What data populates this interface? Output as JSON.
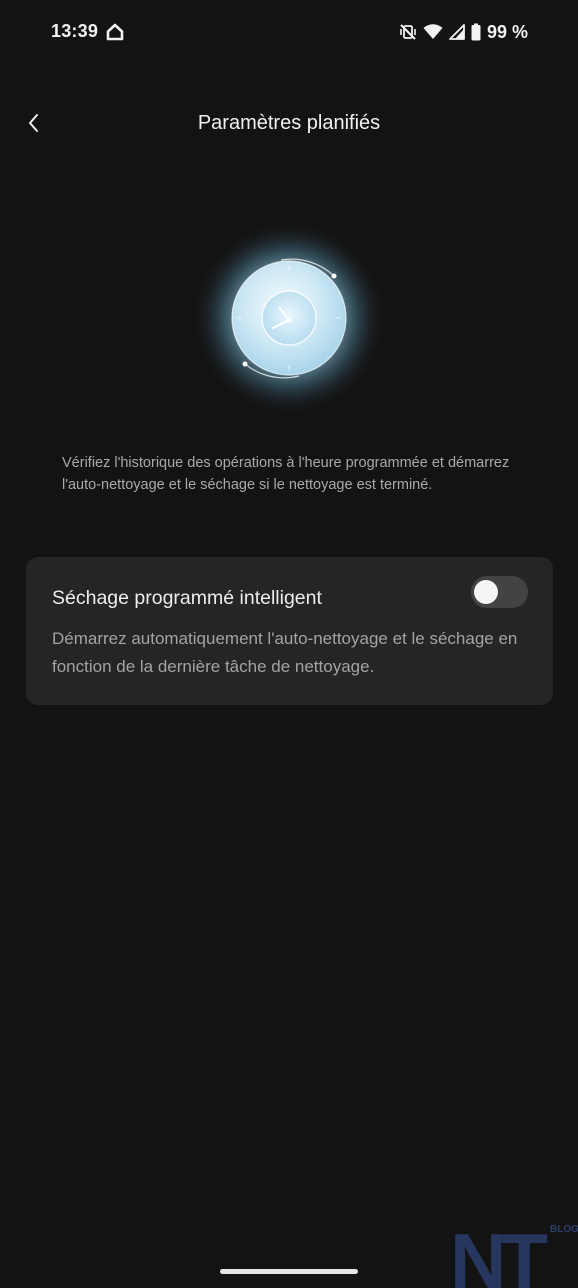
{
  "status_bar": {
    "time": "13:39",
    "battery_text": "99 %",
    "icons": [
      "home-icon",
      "mute-vibrate-icon",
      "wifi-icon",
      "signal-icon",
      "battery-icon"
    ]
  },
  "header": {
    "title": "Paramètres planifiés",
    "back_icon": "chevron-left-icon"
  },
  "description": "Vérifiez l'historique des opérations à l'heure programmée et démarrez l'auto-nettoyage et le séchage si le nettoyage est terminé.",
  "setting": {
    "title": "Séchage programmé intelligent",
    "description": "Démarrez automatiquement l'auto-nettoyage et le séchage en fonction de la dernière tâche de nettoyage.",
    "enabled": false
  },
  "watermark": {
    "logo_text": "NT",
    "logo_sub": "BLOG"
  },
  "colors": {
    "background": "#131313",
    "card": "#252525",
    "toggle_off": "#434343",
    "clock_glow": "#bfe3f2"
  }
}
